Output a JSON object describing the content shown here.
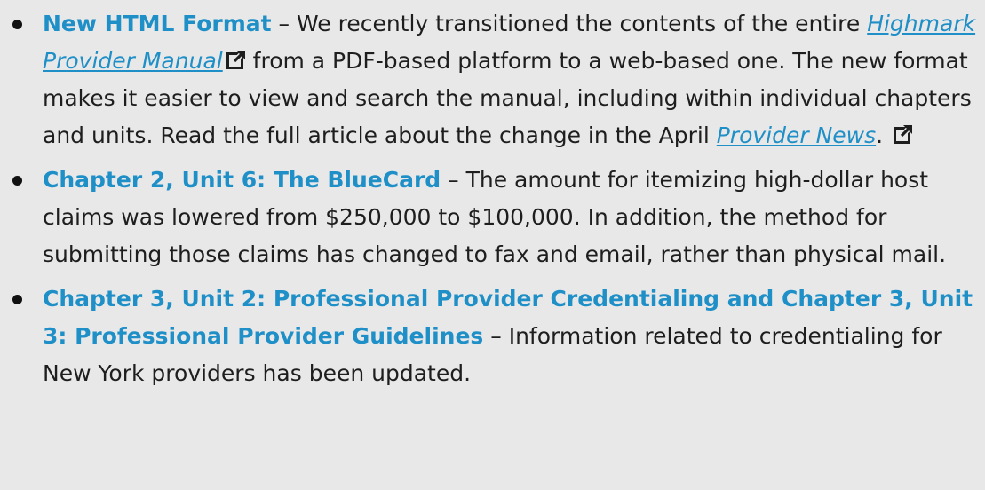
{
  "items": [
    {
      "title": "New HTML Format",
      "dash": " – ",
      "text_before_link": "We recently transitioned the contents of the entire ",
      "link1": "Highmark Provider Manual",
      "text_after_link1": " from a PDF-based platform to a web-based one. The new format makes it easier to view and search the manual, including within individual chapters and units. Read the full article about the change in the April ",
      "link2": "Provider News",
      "text_after_link2": ". "
    },
    {
      "title": "Chapter 2, Unit 6: The BlueCard",
      "dash": " – ",
      "text": "The amount for itemizing high-dollar host claims was lowered from $250,000 to $100,000. In addition, the method for submitting those claims has changed to fax and email, rather than physical mail."
    },
    {
      "title": "Chapter 3, Unit 2: Professional Provider Credentialing and Chapter 3, Unit 3: Professional Provider Guidelines",
      "dash": " – ",
      "text": "Information related to credentialing for New York providers has been updated."
    }
  ],
  "icons": {
    "external_link": "external-link-icon"
  }
}
